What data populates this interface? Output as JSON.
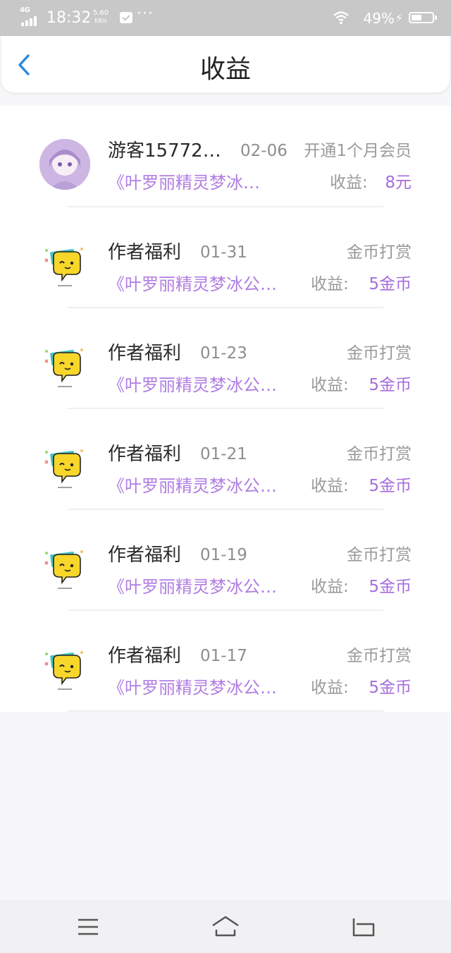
{
  "status_bar": {
    "network": "4G",
    "time": "18:32",
    "speed_value": "5.60",
    "speed_unit": "KB/s",
    "more": "···",
    "battery_percent": "49%",
    "battery_level": 0.49
  },
  "header": {
    "title": "收益",
    "accent_color": "#2d8bdd"
  },
  "records": [
    {
      "name": "游客15772…",
      "date": "02-06",
      "type": "开通1个月会员",
      "book": "《叶罗丽精灵梦冰…",
      "income_label": "收益:",
      "income_value": "8元",
      "avatar_icon": "anime-girl-avatar"
    },
    {
      "name": "作者福利",
      "date": "01-31",
      "type": "金币打赏",
      "book": "《叶罗丽精灵梦冰公…",
      "income_label": "收益:",
      "income_value": "5金币",
      "avatar_icon": "speech-bubble-emoji-avatar"
    },
    {
      "name": "作者福利",
      "date": "01-23",
      "type": "金币打赏",
      "book": "《叶罗丽精灵梦冰公…",
      "income_label": "收益:",
      "income_value": "5金币",
      "avatar_icon": "speech-bubble-emoji-avatar"
    },
    {
      "name": "作者福利",
      "date": "01-21",
      "type": "金币打赏",
      "book": "《叶罗丽精灵梦冰公…",
      "income_label": "收益:",
      "income_value": "5金币",
      "avatar_icon": "speech-bubble-emoji-avatar"
    },
    {
      "name": "作者福利",
      "date": "01-19",
      "type": "金币打赏",
      "book": "《叶罗丽精灵梦冰公…",
      "income_label": "收益:",
      "income_value": "5金币",
      "avatar_icon": "speech-bubble-emoji-avatar"
    },
    {
      "name": "作者福利",
      "date": "01-17",
      "type": "金币打赏",
      "book": "《叶罗丽精灵梦冰公…",
      "income_label": "收益:",
      "income_value": "5金币",
      "avatar_icon": "speech-bubble-emoji-avatar"
    }
  ],
  "nav_bar": {
    "icons": [
      "menu-icon",
      "home-icon",
      "back-icon"
    ]
  }
}
